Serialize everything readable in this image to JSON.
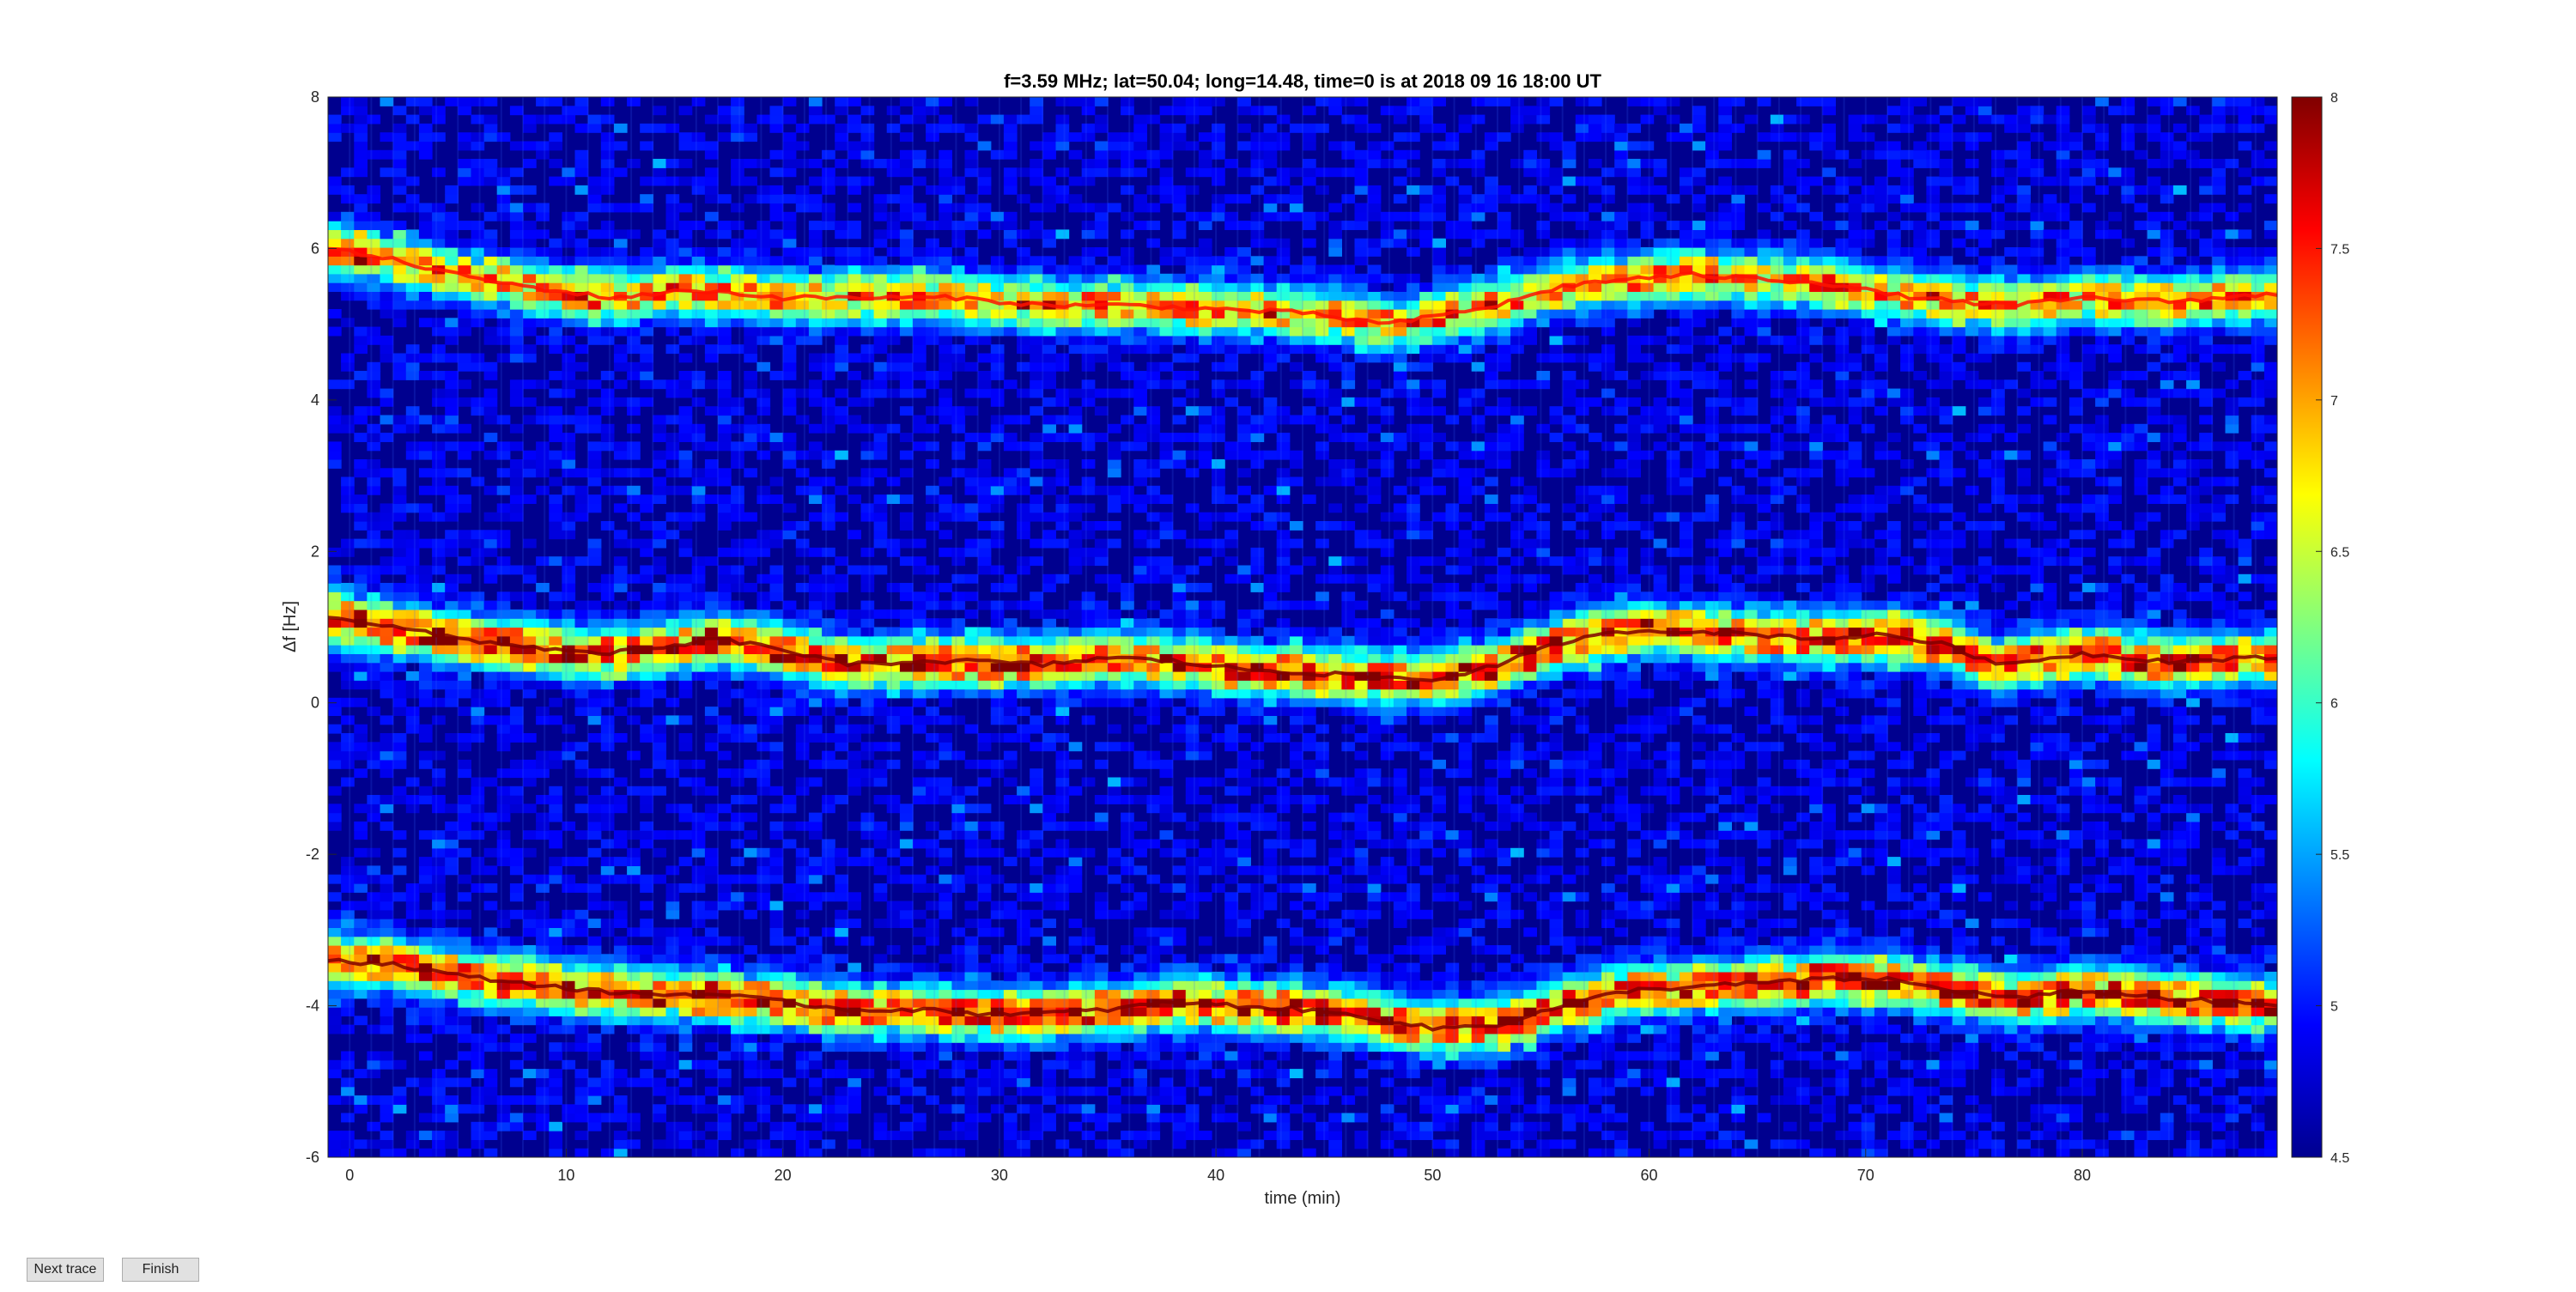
{
  "chart_data": {
    "type": "heatmap",
    "title": "f=3.59 MHz;  lat=50.04; long=14.48, time=0 is at 2018 09 16 18:00 UT",
    "xlabel": "time (min)",
    "ylabel": "Δf [Hz]",
    "xlim": [
      -1,
      89
    ],
    "ylim": [
      -6,
      8
    ],
    "xticks": [
      0,
      10,
      20,
      30,
      40,
      50,
      60,
      70,
      80
    ],
    "yticks": [
      -6,
      -4,
      -2,
      0,
      2,
      4,
      6,
      8
    ],
    "colorbar": {
      "colormap": "jet",
      "clim": [
        4.5,
        8
      ],
      "ticks": [
        "4.5",
        "5",
        "5.5",
        "6",
        "6.5",
        "7",
        "7.5",
        "8"
      ]
    },
    "traces": [
      {
        "x": [
          -1,
          2,
          5,
          8,
          12,
          16,
          20,
          24,
          28,
          32,
          36,
          40,
          44,
          48,
          50,
          53,
          56,
          59,
          62,
          65,
          68,
          71,
          74,
          77,
          80,
          84,
          89
        ],
        "y": [
          6.0,
          5.85,
          5.65,
          5.5,
          5.35,
          5.45,
          5.35,
          5.35,
          5.35,
          5.25,
          5.25,
          5.2,
          5.15,
          5.0,
          5.1,
          5.25,
          5.5,
          5.6,
          5.65,
          5.6,
          5.55,
          5.4,
          5.3,
          5.25,
          5.35,
          5.3,
          5.4
        ],
        "peak": 7.5
      },
      {
        "x": [
          -1,
          2,
          5,
          8,
          11,
          14,
          17,
          20,
          23,
          26,
          29,
          32,
          35,
          38,
          41,
          44,
          47,
          50,
          53,
          56,
          59,
          62,
          65,
          68,
          71,
          74,
          76,
          80,
          84,
          89
        ],
        "y": [
          1.15,
          1.0,
          0.85,
          0.75,
          0.65,
          0.7,
          0.85,
          0.7,
          0.5,
          0.55,
          0.55,
          0.5,
          0.6,
          0.55,
          0.45,
          0.4,
          0.35,
          0.3,
          0.5,
          0.8,
          0.95,
          0.95,
          0.9,
          0.85,
          0.9,
          0.75,
          0.5,
          0.65,
          0.55,
          0.6
        ],
        "peak": 8
      },
      {
        "x": [
          -1,
          2,
          5,
          8,
          11,
          14,
          17,
          20,
          23,
          26,
          29,
          32,
          35,
          38,
          41,
          44,
          47,
          50,
          53,
          56,
          59,
          62,
          65,
          68,
          71,
          74,
          77,
          80,
          84,
          89
        ],
        "y": [
          -3.4,
          -3.45,
          -3.6,
          -3.7,
          -3.8,
          -3.85,
          -3.85,
          -3.95,
          -4.05,
          -4.05,
          -4.1,
          -4.1,
          -4.05,
          -3.95,
          -4.0,
          -4.05,
          -4.15,
          -4.3,
          -4.25,
          -4.0,
          -3.8,
          -3.75,
          -3.7,
          -3.65,
          -3.65,
          -3.8,
          -3.9,
          -3.8,
          -3.9,
          -4.0
        ],
        "peak": 8
      }
    ]
  },
  "controls": {
    "next_trace_label": "Next trace",
    "finish_label": "Finish"
  }
}
